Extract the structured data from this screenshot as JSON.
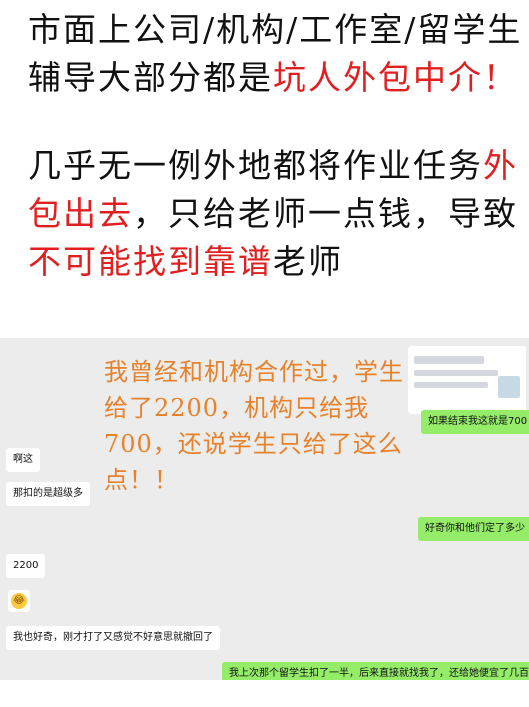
{
  "headline": {
    "p1_a": "市面上公司/机构/工作室/留学生辅导大部分都是",
    "p1_red": "坑人外包中介！",
    "p2_red1": "外包出去",
    "p2_a": "几乎无一例外地都将作业任务",
    "p2_b": "，只给老师一点钱，导致",
    "p2_red2": "不可能找到靠谱",
    "p2_c": "老师"
  },
  "overlay": {
    "text": "我曾经和机构合作过，学生给了2200，机构只给我700，还说学生只给了这么点！！"
  },
  "chat": {
    "messages": [
      {
        "side": "right",
        "text": "如果结束我这就是700"
      },
      {
        "side": "left",
        "text": "啊这"
      },
      {
        "side": "left",
        "text": "那扣的是超级多"
      },
      {
        "side": "right",
        "text": "好奇你和他们定了多少"
      },
      {
        "side": "left",
        "text": "2200"
      },
      {
        "side": "left",
        "text": "我也好奇，刚才打了又感觉不好意思就撤回了"
      },
      {
        "side": "right",
        "text": "我上次那个留学生扣了一半，后来直接就找我了，还给她便宜了几百"
      }
    ],
    "emoji_icon": "laughing-emoji-icon"
  }
}
